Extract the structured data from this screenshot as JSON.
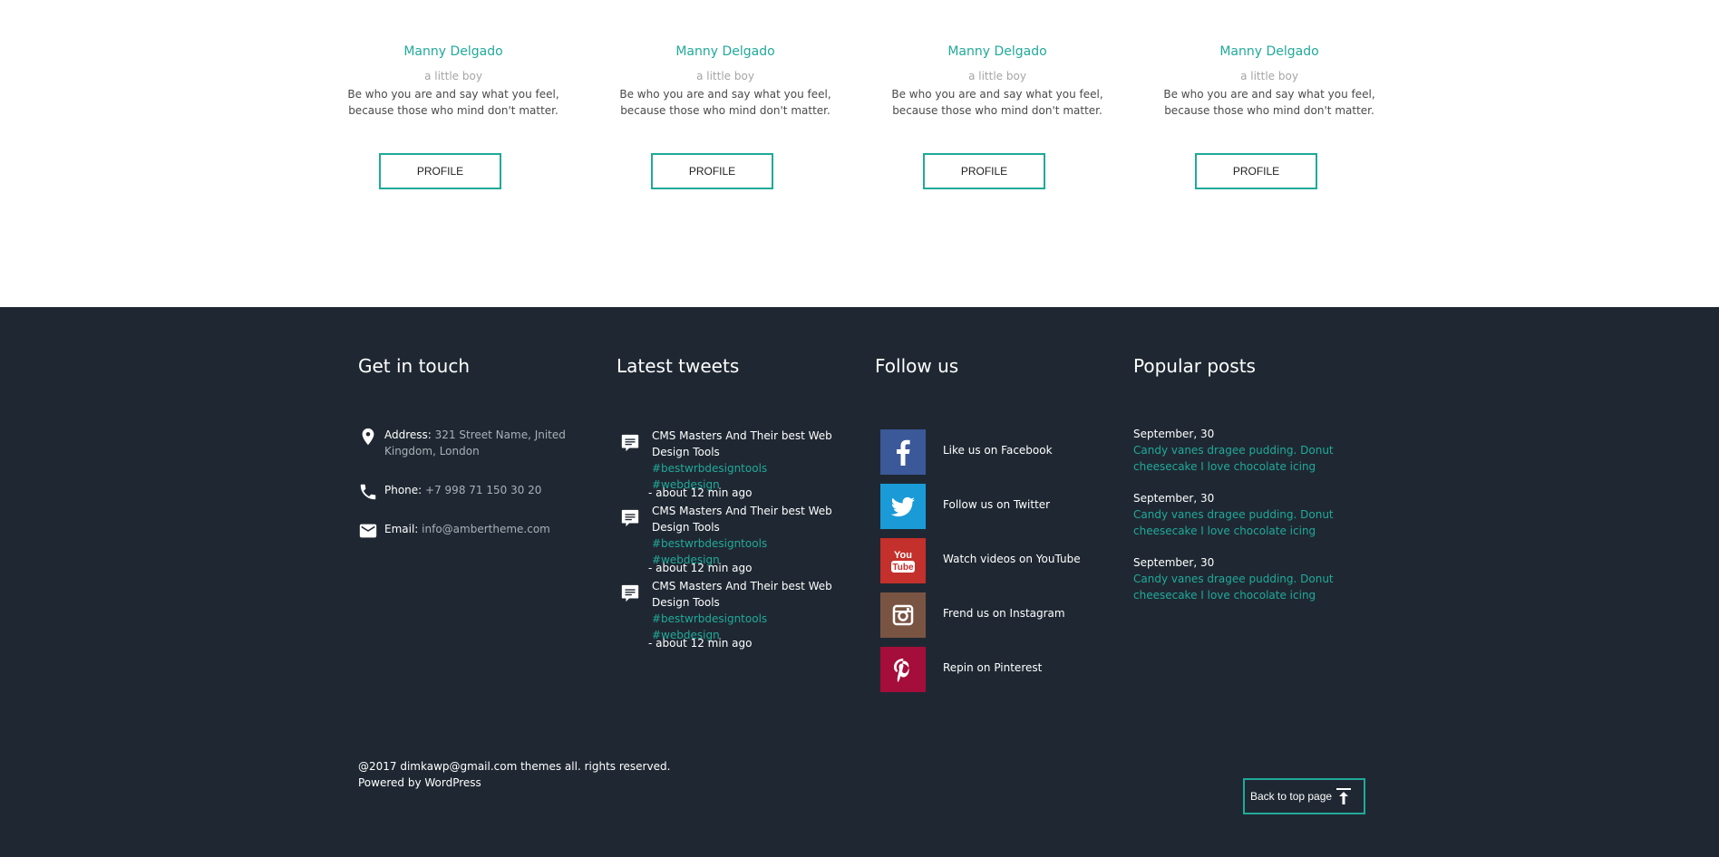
{
  "team": {
    "members": [
      {
        "name": "Manny Delgado",
        "role": "a little boy",
        "quote_line1": "Be who you are and say what you feel,",
        "quote_line2": "because those who mind don't matter.",
        "button": "PROFILE"
      },
      {
        "name": "Manny Delgado",
        "role": "a little boy",
        "quote_line1": "Be who you are and say what you feel,",
        "quote_line2": "because those who mind don't matter.",
        "button": "PROFILE"
      },
      {
        "name": "Manny Delgado",
        "role": "a little boy",
        "quote_line1": "Be who you are and say what you feel,",
        "quote_line2": "because those who mind don't matter.",
        "button": "PROFILE"
      },
      {
        "name": "Manny Delgado",
        "role": "a little boy",
        "quote_line1": "Be who you are and say what you feel,",
        "quote_line2": "because those who mind don't matter.",
        "button": "PROFILE"
      }
    ]
  },
  "footer": {
    "contact": {
      "title": "Get in touch",
      "address_label": "Address:",
      "address_line1": "321 Street Name, Jnited",
      "address_line2": "Kingdom, London",
      "phone_label": "Phone:",
      "phone": "+7 998 71 150 30 20",
      "email_label": "Email:",
      "email": "info@ambertheme.com"
    },
    "tweets": {
      "title": "Latest tweets",
      "items": [
        {
          "line1": "CMS Masters And Their best Web",
          "line2": "Design Tools",
          "tag1": "#bestwrbdesigntools",
          "tag2": "#webdesign",
          "time": "- about 12 min ago"
        },
        {
          "line1": "CMS Masters And Their best Web",
          "line2": "Design Tools",
          "tag1": "#bestwrbdesigntools",
          "tag2": "#webdesign",
          "time": "- about 12 min ago"
        },
        {
          "line1": "CMS Masters And Their best Web",
          "line2": "Design Tools",
          "tag1": "#bestwrbdesigntools",
          "tag2": "#webdesign",
          "time": "- about 12 min ago"
        }
      ]
    },
    "follow": {
      "title": "Follow us",
      "items": [
        {
          "label": "Like us on Facebook",
          "icon": "facebook-icon",
          "color": "#3b5998"
        },
        {
          "label": "Follow us on Twitter",
          "icon": "twitter-icon",
          "color": "#1a9bd7"
        },
        {
          "label": "Watch videos on YouTube",
          "icon": "youtube-icon",
          "color": "#c4302b"
        },
        {
          "label": "Frend us on Instagram",
          "icon": "instagram-icon",
          "color": "#7a5443"
        },
        {
          "label": "Repin on Pinterest",
          "icon": "pinterest-icon",
          "color": "#a50d3a"
        }
      ]
    },
    "posts": {
      "title": "Popular posts",
      "items": [
        {
          "date": "September, 30",
          "line1": "Candy vanes dragee pudding. Donut",
          "line2": "cheesecake I love chocolate icing"
        },
        {
          "date": "September, 30",
          "line1": "Candy vanes dragee pudding. Donut",
          "line2": "cheesecake I love chocolate icing"
        },
        {
          "date": "September, 30",
          "line1": "Candy vanes dragee pudding. Donut",
          "line2": "cheesecake I love chocolate icing"
        }
      ]
    },
    "copyright_line1": "@2017 dimkawp@gmail.com themes all. rights reserved.",
    "copyright_line2": "Powered by WordPress",
    "back_to_top": "Back to top page"
  },
  "colors": {
    "accent": "#21a99a",
    "footer_bg": "#1f2832"
  }
}
